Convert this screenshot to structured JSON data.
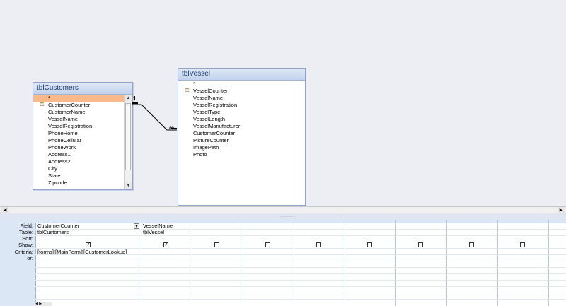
{
  "tables": [
    {
      "name": "tblCustomers",
      "fields": [
        "*",
        "CustomerCounter",
        "CustomerName",
        "VesselName",
        "VesselRegistration",
        "PhoneHome",
        "PhoneCellular",
        "PhoneWork",
        "Address1",
        "Address2",
        "City",
        "State",
        "Zipcode"
      ],
      "key_field": "CustomerCounter"
    },
    {
      "name": "tblVessel",
      "fields": [
        "*",
        "VesselCounter",
        "VesselName",
        "VesselRegistration",
        "VesselType",
        "VesselLength",
        "VesselManufacturer",
        "CustomerCounter",
        "PictureCounter",
        "ImagePath",
        "Photo"
      ],
      "key_field": "VesselCounter"
    }
  ],
  "relationship": {
    "one_label": "1",
    "many_label": "∞"
  },
  "grid": {
    "row_labels": [
      "Field:",
      "Table:",
      "Sort:",
      "Show:",
      "Criteria:",
      "or:"
    ],
    "columns": [
      {
        "field": "CustomerCounter",
        "table": "tblCustomers",
        "sort": "",
        "show": true,
        "criteria": "[forms]![MainForm]![CustomerLookup]",
        "or": ""
      },
      {
        "field": "VesselName",
        "table": "tblVessel",
        "sort": "",
        "show": true,
        "criteria": "",
        "or": ""
      },
      {
        "field": "",
        "table": "",
        "sort": "",
        "show": false,
        "criteria": "",
        "or": ""
      },
      {
        "field": "",
        "table": "",
        "sort": "",
        "show": false,
        "criteria": "",
        "or": ""
      },
      {
        "field": "",
        "table": "",
        "sort": "",
        "show": false,
        "criteria": "",
        "or": ""
      },
      {
        "field": "",
        "table": "",
        "sort": "",
        "show": false,
        "criteria": "",
        "or": ""
      },
      {
        "field": "",
        "table": "",
        "sort": "",
        "show": false,
        "criteria": "",
        "or": ""
      },
      {
        "field": "",
        "table": "",
        "sort": "",
        "show": false,
        "criteria": "",
        "or": ""
      },
      {
        "field": "",
        "table": "",
        "sort": "",
        "show": false,
        "criteria": "",
        "or": ""
      },
      {
        "field": "",
        "table": "",
        "sort": "",
        "show": false,
        "criteria": "",
        "or": ""
      }
    ]
  },
  "checkmark": "✓"
}
